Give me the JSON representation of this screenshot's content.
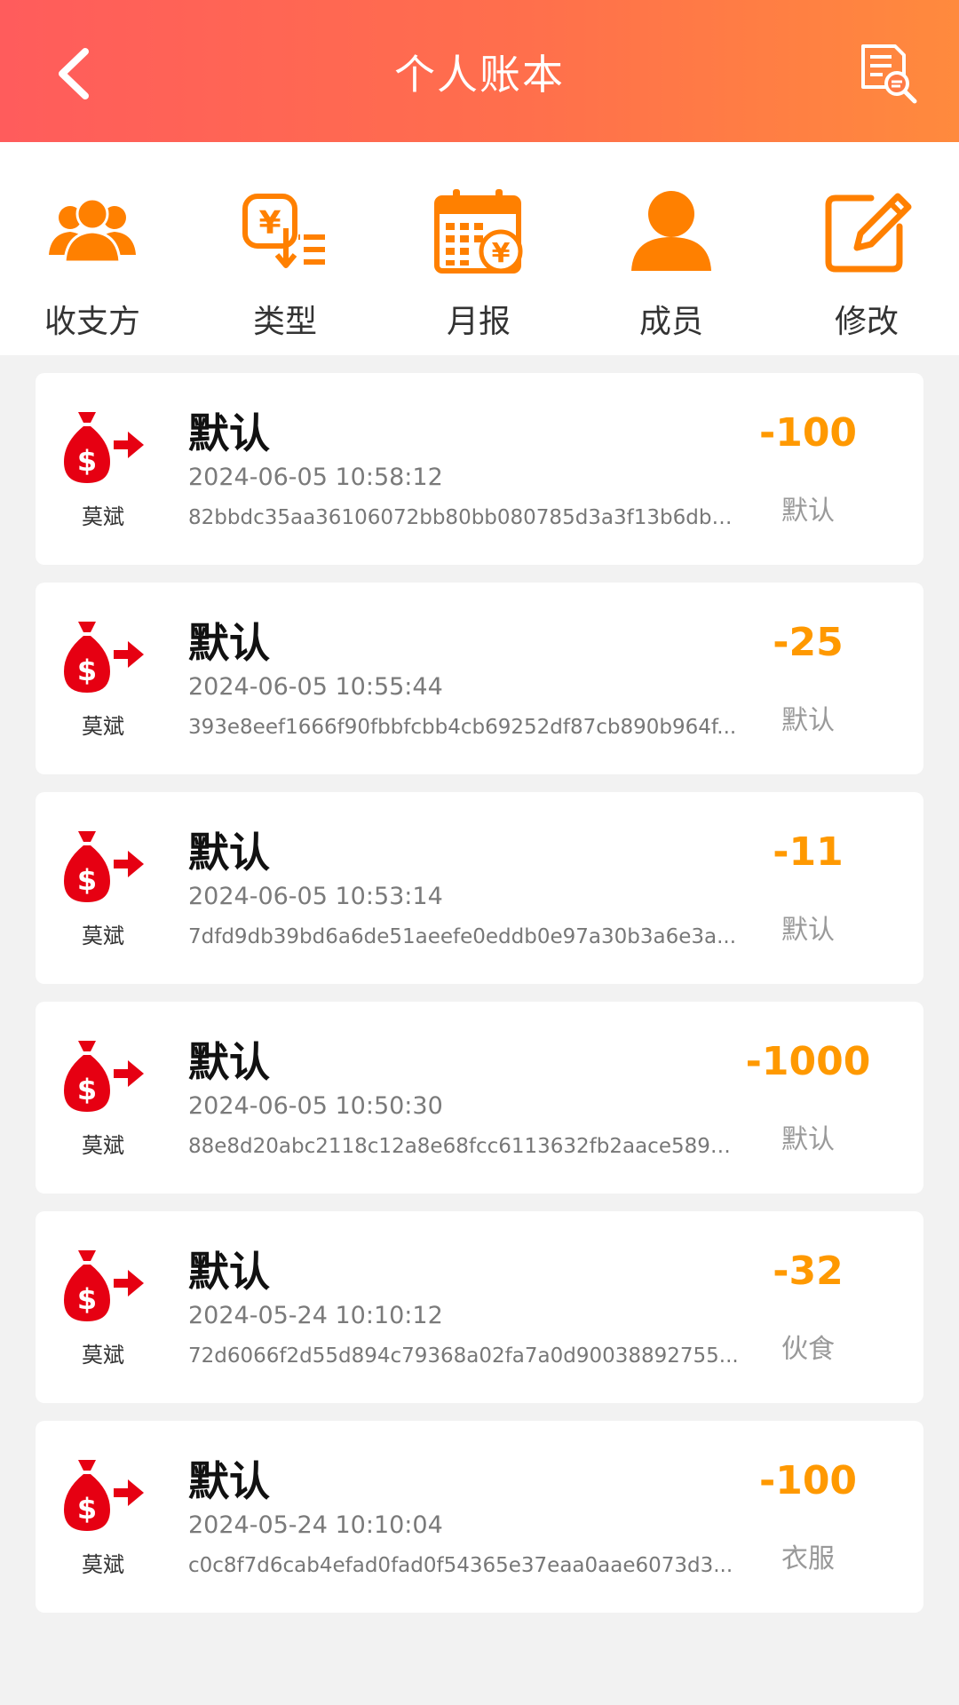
{
  "header": {
    "title": "个人账本"
  },
  "quick_actions": [
    {
      "label": "收支方",
      "icon": "people-group-icon"
    },
    {
      "label": "类型",
      "icon": "yuan-sort-icon"
    },
    {
      "label": "月报",
      "icon": "calendar-yuan-icon"
    },
    {
      "label": "成员",
      "icon": "person-icon"
    },
    {
      "label": "修改",
      "icon": "edit-pencil-icon"
    }
  ],
  "colors": {
    "accent": "#ff8000",
    "header_start": "#ff5c5c",
    "header_end": "#ff8a3d",
    "amount": "#ff9900",
    "bag_red": "#e60012"
  },
  "records": [
    {
      "title": "默认",
      "time": "2024-06-05 10:58:12",
      "hash": "82bbdc35aa36106072bb80bb080785d3a3f13b6db5...",
      "amount": "-100",
      "type": "默认",
      "member": "莫斌"
    },
    {
      "title": "默认",
      "time": "2024-06-05 10:55:44",
      "hash": "393e8eef1666f90fbbfcbb4cb69252df87cb890b964f...",
      "amount": "-25",
      "type": "默认",
      "member": "莫斌"
    },
    {
      "title": "默认",
      "time": "2024-06-05 10:53:14",
      "hash": "7dfd9db39bd6a6de51aeefe0eddb0e97a30b3a6e3a...",
      "amount": "-11",
      "type": "默认",
      "member": "莫斌"
    },
    {
      "title": "默认",
      "time": "2024-06-05 10:50:30",
      "hash": "88e8d20abc2118c12a8e68fcc6113632fb2aace5896...",
      "amount": "-1000",
      "type": "默认",
      "member": "莫斌"
    },
    {
      "title": "默认",
      "time": "2024-05-24 10:10:12",
      "hash": "72d6066f2d55d894c79368a02fa7a0d90038892755...",
      "amount": "-32",
      "type": "伙食",
      "member": "莫斌"
    },
    {
      "title": "默认",
      "time": "2024-05-24 10:10:04",
      "hash": "c0c8f7d6cab4efad0fad0f54365e37eaa0aae6073d3...",
      "amount": "-100",
      "type": "衣服",
      "member": "莫斌"
    }
  ]
}
